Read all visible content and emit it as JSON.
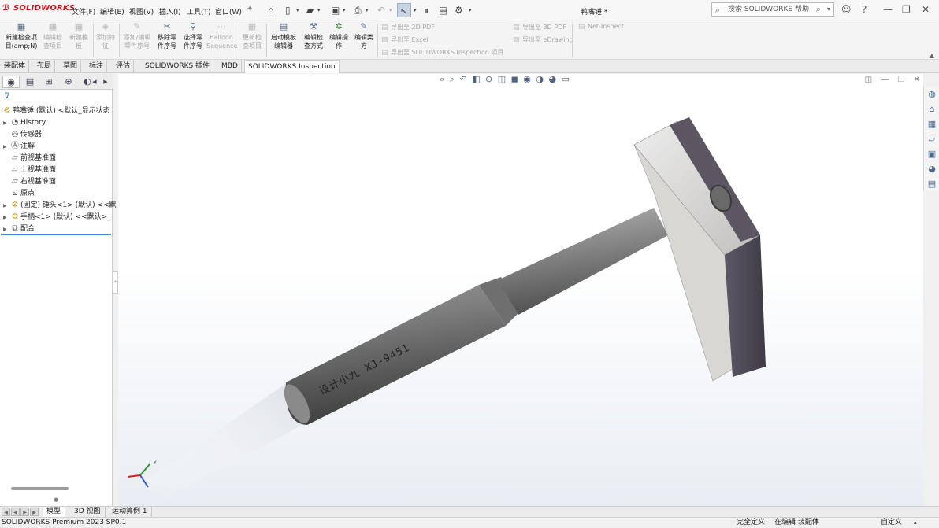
{
  "app": {
    "brand": "SOLIDWORKS",
    "document_title": "鸭嘴锤 *"
  },
  "menu": [
    "文件(F)",
    "编辑(E)",
    "视图(V)",
    "插入(I)",
    "工具(T)",
    "窗口(W)"
  ],
  "search": {
    "placeholder": "搜索 SOLIDWORKS 帮助"
  },
  "command_manager": {
    "buttons": [
      {
        "label1": "新建检查项",
        "label2": "目(amp;N)",
        "enabled": true
      },
      {
        "label1": "编辑检",
        "label2": "查项目",
        "enabled": false
      },
      {
        "label1": "新建模",
        "label2": "板",
        "enabled": false
      },
      {
        "label1": "添加特",
        "label2": "征",
        "enabled": false
      },
      {
        "label1": "添加/编辑",
        "label2": "零件序号",
        "enabled": false
      },
      {
        "label1": "移除零",
        "label2": "件序号",
        "enabled": true
      },
      {
        "label1": "选择零",
        "label2": "件序号",
        "enabled": true
      },
      {
        "label1": "Balloon",
        "label2": "Sequence",
        "enabled": false
      },
      {
        "label1": "更新检",
        "label2": "查项目",
        "enabled": false
      },
      {
        "label1": "启动模板",
        "label2": "编辑器",
        "enabled": true
      },
      {
        "label1": "编辑检",
        "label2": "查方式",
        "enabled": true
      },
      {
        "label1": "编辑操",
        "label2": "作",
        "enabled": true
      },
      {
        "label1": "编辑类",
        "label2": "方",
        "enabled": true
      }
    ],
    "export": {
      "to_2d_pdf": "导出至 2D PDF",
      "to_excel": "导出至 Excel",
      "to_sw_inspection": "导出至 SOLIDWORKS Inspection 项目",
      "to_3d_pdf": "导出至 3D PDF",
      "to_edrawing": "导出至 eDrawing",
      "net_inspect": "Net-Inspect"
    }
  },
  "tabs": [
    "装配体",
    "布局",
    "草图",
    "标注",
    "评估",
    "SOLIDWORKS 插件",
    "MBD",
    "SOLIDWORKS Inspection"
  ],
  "active_tab": "SOLIDWORKS Inspection",
  "feature_tree": {
    "root": "鸭嘴锤 (默认) <默认_显示状态",
    "items": [
      {
        "label": "History",
        "expandable": true
      },
      {
        "label": "传感器",
        "expandable": false
      },
      {
        "label": "注解",
        "expandable": true
      },
      {
        "label": "前视基准面",
        "expandable": false
      },
      {
        "label": "上视基准面",
        "expandable": false
      },
      {
        "label": "右视基准面",
        "expandable": false
      },
      {
        "label": "原点",
        "expandable": false
      },
      {
        "label": "(固定) 锤头<1> (默认) <<默",
        "expandable": true
      },
      {
        "label": "手柄<1> (默认) <<默认>_",
        "expandable": true
      },
      {
        "label": "配合",
        "expandable": true
      }
    ]
  },
  "model": {
    "engraving": "设计小九   XJ-9451"
  },
  "bottom_tabs": [
    "模型",
    "3D 视图",
    "运动算例 1"
  ],
  "active_bottom_tab": "模型",
  "status": {
    "product": "SOLIDWORKS Premium 2023 SP0.1",
    "definition": "完全定义",
    "editing": "在编辑 装配体",
    "custom": "自定义"
  },
  "triad": {
    "y": "Y"
  },
  "colors": {
    "accent": "#3b8ed6",
    "brand": "#d0121b"
  }
}
